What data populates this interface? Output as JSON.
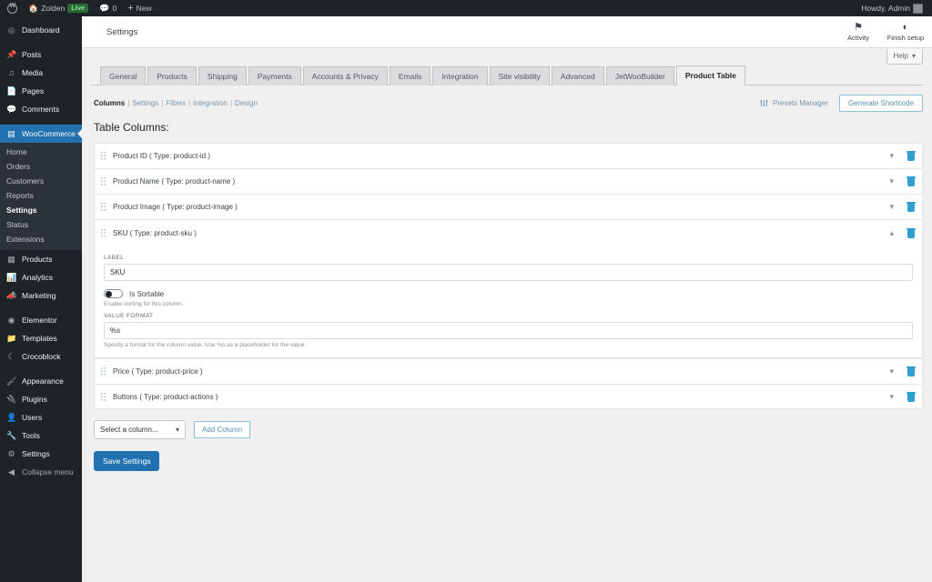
{
  "adminbar": {
    "logo_icon": "wordpress-logo-icon",
    "site_icon": "home-icon",
    "site_name": "Zolden",
    "live_badge": "Live",
    "comment_icon": "comment-icon",
    "comment_count": "0",
    "new_icon": "plus-icon",
    "new_label": "New",
    "howdy": "Howdy, Admin",
    "avatar": "user-avatar"
  },
  "sidebar": {
    "items": [
      {
        "label": "Dashboard",
        "icon": "dashboard-icon",
        "name": "dashboard"
      },
      {
        "label": "Posts",
        "icon": "pin-icon",
        "name": "posts"
      },
      {
        "label": "Media",
        "icon": "media-icon",
        "name": "media"
      },
      {
        "label": "Pages",
        "icon": "page-icon",
        "name": "pages"
      },
      {
        "label": "Comments",
        "icon": "comment-icon",
        "name": "comments"
      },
      {
        "label": "WooCommerce",
        "icon": "woocommerce-icon",
        "name": "woocommerce"
      },
      {
        "label": "Products",
        "icon": "products-icon",
        "name": "products"
      },
      {
        "label": "Analytics",
        "icon": "chart-icon",
        "name": "analytics"
      },
      {
        "label": "Marketing",
        "icon": "megaphone-icon",
        "name": "marketing"
      },
      {
        "label": "Elementor",
        "icon": "elementor-icon",
        "name": "elementor"
      },
      {
        "label": "Templates",
        "icon": "folder-icon",
        "name": "templates"
      },
      {
        "label": "Crocoblock",
        "icon": "moon-icon",
        "name": "crocoblock"
      },
      {
        "label": "Appearance",
        "icon": "brush-icon",
        "name": "appearance"
      },
      {
        "label": "Plugins",
        "icon": "plug-icon",
        "name": "plugins"
      },
      {
        "label": "Users",
        "icon": "user-icon",
        "name": "users"
      },
      {
        "label": "Tools",
        "icon": "wrench-icon",
        "name": "tools"
      },
      {
        "label": "Settings",
        "icon": "sliders-icon",
        "name": "settings"
      },
      {
        "label": "Collapse menu",
        "icon": "collapse-icon",
        "name": "collapse-menu"
      }
    ],
    "woo_submenu": [
      {
        "label": "Home",
        "name": "home"
      },
      {
        "label": "Orders",
        "name": "orders"
      },
      {
        "label": "Customers",
        "name": "customers"
      },
      {
        "label": "Reports",
        "name": "reports"
      },
      {
        "label": "Settings",
        "name": "settings"
      },
      {
        "label": "Status",
        "name": "status"
      },
      {
        "label": "Extensions",
        "name": "extensions"
      }
    ]
  },
  "header": {
    "title": "Settings",
    "activity_icon": "flag-icon",
    "activity_label": "Activity",
    "setup_icon": "half-circle-icon",
    "setup_label": "Finish setup",
    "help_label": "Help",
    "help_caret": "chevron-down-icon"
  },
  "tabs": [
    {
      "label": "General",
      "active": false
    },
    {
      "label": "Products",
      "active": false
    },
    {
      "label": "Shipping",
      "active": false
    },
    {
      "label": "Payments",
      "active": false
    },
    {
      "label": "Accounts & Privacy",
      "active": false
    },
    {
      "label": "Emails",
      "active": false
    },
    {
      "label": "Integration",
      "active": false
    },
    {
      "label": "Site visibility",
      "active": false
    },
    {
      "label": "Advanced",
      "active": false
    },
    {
      "label": "JetWooBuilder",
      "active": false
    },
    {
      "label": "Product Table",
      "active": true
    }
  ],
  "subnav": {
    "items": [
      {
        "label": "Columns",
        "current": true
      },
      {
        "label": "Settings",
        "current": false
      },
      {
        "label": "Filters",
        "current": false
      },
      {
        "label": "Integration",
        "current": false
      },
      {
        "label": "Design",
        "current": false
      }
    ],
    "presets_manager": "Presets Manager",
    "presets_icon": "sliders-icon",
    "generate_shortcode": "Generate Shortcode"
  },
  "content": {
    "section_title": "Table Columns:",
    "rows": [
      {
        "label": "Product ID ( Type: product-id )",
        "expanded": false,
        "chevron": "chevron-down-icon"
      },
      {
        "label": "Product Name ( Type: product-name )",
        "expanded": false,
        "chevron": "chevron-down-icon"
      },
      {
        "label": "Product Image ( Type: product-image )",
        "expanded": false,
        "chevron": "chevron-down-icon"
      },
      {
        "label": "SKU ( Type: product-sku )",
        "expanded": true,
        "chevron": "chevron-up-icon"
      },
      {
        "label": "Price ( Type: product-price )",
        "expanded": false,
        "chevron": "chevron-down-icon"
      },
      {
        "label": "Buttons ( Type: product-actions )",
        "expanded": false,
        "chevron": "chevron-down-icon"
      }
    ],
    "expanded_form": {
      "label_field_label": "LABEL",
      "label_field_value": "SKU",
      "sortable_label": "Is Sortable",
      "sortable_on": false,
      "sortable_desc": "Enable sorting for this column.",
      "format_field_label": "VALUE FORMAT",
      "format_field_value": "%s",
      "format_desc": "Specify a format for the column value. Use %s as a placeholder for the value."
    },
    "select_column_value": "Select a column...",
    "select_caret": "chevron-down-icon",
    "add_column_label": "Add Column",
    "save_label": "Save Settings"
  },
  "colors": {
    "wp_blue": "#2271b1",
    "admin_dark": "#1d2327",
    "trash_blue": "#2e9fd0",
    "live_green": "#8fe09a"
  }
}
